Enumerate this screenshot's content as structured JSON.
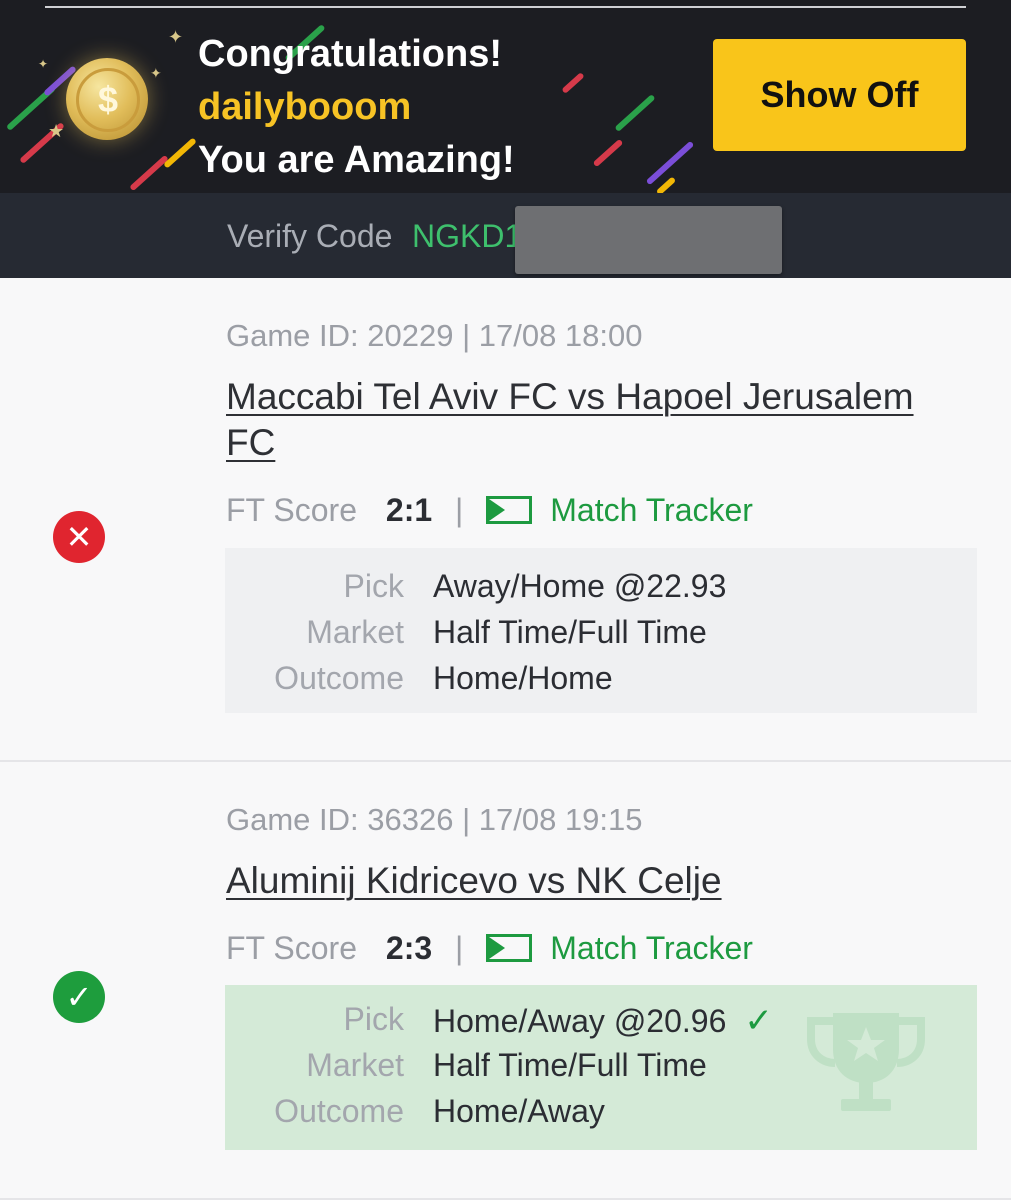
{
  "banner": {
    "line1": "Congratulations!",
    "username": "dailybooom",
    "line3": "You are Amazing!",
    "show_off_label": "Show Off",
    "coin_symbol": "$",
    "colors": {
      "accent": "#f9c51a",
      "username": "#f7c325",
      "background": "#1c1d22"
    }
  },
  "verify": {
    "label": "Verify Code",
    "code_visible": "NGKD1"
  },
  "bets": [
    {
      "status": "lost",
      "status_icon": "x-circle-icon",
      "game_id": "Game ID: 20229 | 17/08 18:00",
      "match": "Maccabi Tel Aviv FC vs Hapoel Jerusalem FC",
      "ft_label": "FT Score",
      "ft_score": "2:1",
      "separator": "|",
      "tracker_label": "Match Tracker",
      "pick_label": "Pick",
      "pick": "Away/Home @22.93",
      "market_label": "Market",
      "market": "Half Time/Full Time",
      "outcome_label": "Outcome",
      "outcome": "Home/Home"
    },
    {
      "status": "won",
      "status_icon": "check-circle-icon",
      "game_id": "Game ID: 36326 | 17/08 19:15",
      "match": "Aluminij Kidricevo vs NK Celje",
      "ft_label": "FT Score",
      "ft_score": "2:3",
      "separator": "|",
      "tracker_label": "Match Tracker",
      "pick_label": "Pick",
      "pick": "Home/Away @20.96",
      "market_label": "Market",
      "market": "Half Time/Full Time",
      "outcome_label": "Outcome",
      "outcome": "Home/Away"
    }
  ],
  "colors": {
    "won": "#1e9d3d",
    "lost": "#e0252f",
    "tracker": "#1d9a40"
  }
}
